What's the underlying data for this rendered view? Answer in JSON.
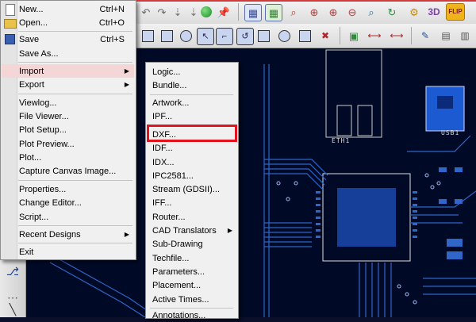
{
  "file_menu": {
    "items": [
      {
        "label": "New...",
        "shortcut": "Ctrl+N"
      },
      {
        "label": "Open...",
        "shortcut": "Ctrl+O"
      },
      {
        "label": "Save",
        "shortcut": "Ctrl+S"
      },
      {
        "label": "Save As...",
        "shortcut": ""
      },
      {
        "label": "Import",
        "shortcut": ""
      },
      {
        "label": "Export",
        "shortcut": ""
      },
      {
        "label": "Viewlog...",
        "shortcut": ""
      },
      {
        "label": "File Viewer...",
        "shortcut": ""
      },
      {
        "label": "Plot Setup...",
        "shortcut": ""
      },
      {
        "label": "Plot Preview...",
        "shortcut": ""
      },
      {
        "label": "Plot...",
        "shortcut": ""
      },
      {
        "label": "Capture Canvas Image...",
        "shortcut": ""
      },
      {
        "label": "Properties...",
        "shortcut": ""
      },
      {
        "label": "Change Editor...",
        "shortcut": ""
      },
      {
        "label": "Script...",
        "shortcut": ""
      },
      {
        "label": "Recent Designs",
        "shortcut": ""
      },
      {
        "label": "Exit",
        "shortcut": ""
      }
    ]
  },
  "import_menu": {
    "items": [
      {
        "label": "Logic..."
      },
      {
        "label": "Bundle..."
      },
      {
        "label": "Artwork..."
      },
      {
        "label": "IPF..."
      },
      {
        "label": "DXF..."
      },
      {
        "label": "IDF..."
      },
      {
        "label": "IDX..."
      },
      {
        "label": "IPC2581..."
      },
      {
        "label": "Stream (GDSII)..."
      },
      {
        "label": "IFF..."
      },
      {
        "label": "Router..."
      },
      {
        "label": "CAD Translators"
      },
      {
        "label": "Sub-Drawing"
      },
      {
        "label": "Techfile..."
      },
      {
        "label": "Parameters..."
      },
      {
        "label": "Placement..."
      },
      {
        "label": "Active Times..."
      },
      {
        "label": "Annotations..."
      }
    ]
  },
  "canvas": {
    "labels": {
      "eth": "ETH1",
      "usb": "USB1"
    }
  },
  "colors": {
    "board_background": "#000a26",
    "trace_blue": "#2f66c8",
    "silkscreen": "#d8d8d8",
    "highlight_box": "#e2131f",
    "menu_hover": "#f4d6d6"
  },
  "toolbar": {
    "icons": [
      "undo-icon",
      "redo-icon",
      "move-down-icon",
      "move-down-icon",
      "globe-icon",
      "pin-icon",
      "grid-icon",
      "grid-color-icon",
      "zoom-fit-icon",
      "zoom-in-icon",
      "zoom-out-icon",
      "zoom-world-icon",
      "zoom-previous-icon",
      "refresh-icon",
      "3d-view-icon",
      "flip-icon",
      "square-icon",
      "square-icon",
      "circle-icon",
      "select-icon",
      "shape-icon",
      "rotate-icon",
      "square-icon",
      "circle-icon",
      "square-icon",
      "delete-icon",
      "measure-icon",
      "dimension-icon",
      "dimension-icon",
      "add-text-icon",
      "properties-icon",
      "layers-icon"
    ]
  }
}
